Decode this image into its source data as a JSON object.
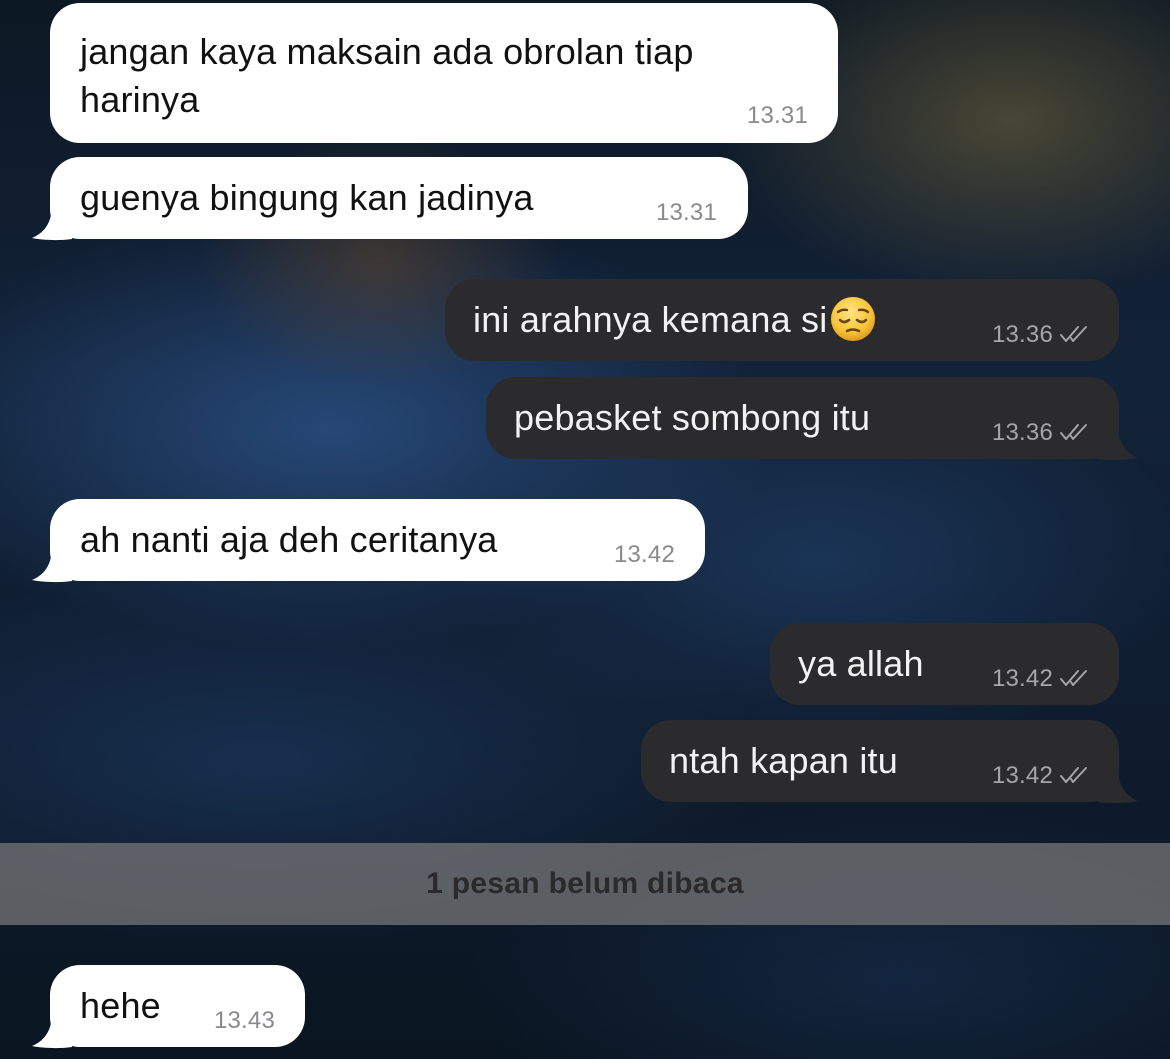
{
  "colors": {
    "incoming_bubble": "#ffffff",
    "outgoing_bubble": "#2b2b2d",
    "unread_bar": "#6e6e70"
  },
  "messages": [
    {
      "direction": "incoming",
      "text_line1": "jangan kaya maksain ada obrolan tiap",
      "text_line2": "harinya",
      "time": "13.31"
    },
    {
      "direction": "incoming",
      "text": "guenya bingung kan jadinya",
      "time": "13.31"
    },
    {
      "direction": "outgoing",
      "text": "ini arahnya kemana si",
      "emoji": "pensive-face-icon",
      "time": "13.36",
      "status": "read-double-check-icon"
    },
    {
      "direction": "outgoing",
      "text": "pebasket sombong itu",
      "time": "13.36",
      "status": "read-double-check-icon"
    },
    {
      "direction": "incoming",
      "text": "ah nanti aja deh ceritanya",
      "time": "13.42"
    },
    {
      "direction": "outgoing",
      "text": "ya allah",
      "time": "13.42",
      "status": "read-double-check-icon"
    },
    {
      "direction": "outgoing",
      "text": "ntah kapan itu",
      "time": "13.42",
      "status": "read-double-check-icon"
    },
    {
      "direction": "incoming",
      "text": "hehe",
      "time": "13.43"
    }
  ],
  "unread_banner": "1 pesan belum dibaca"
}
